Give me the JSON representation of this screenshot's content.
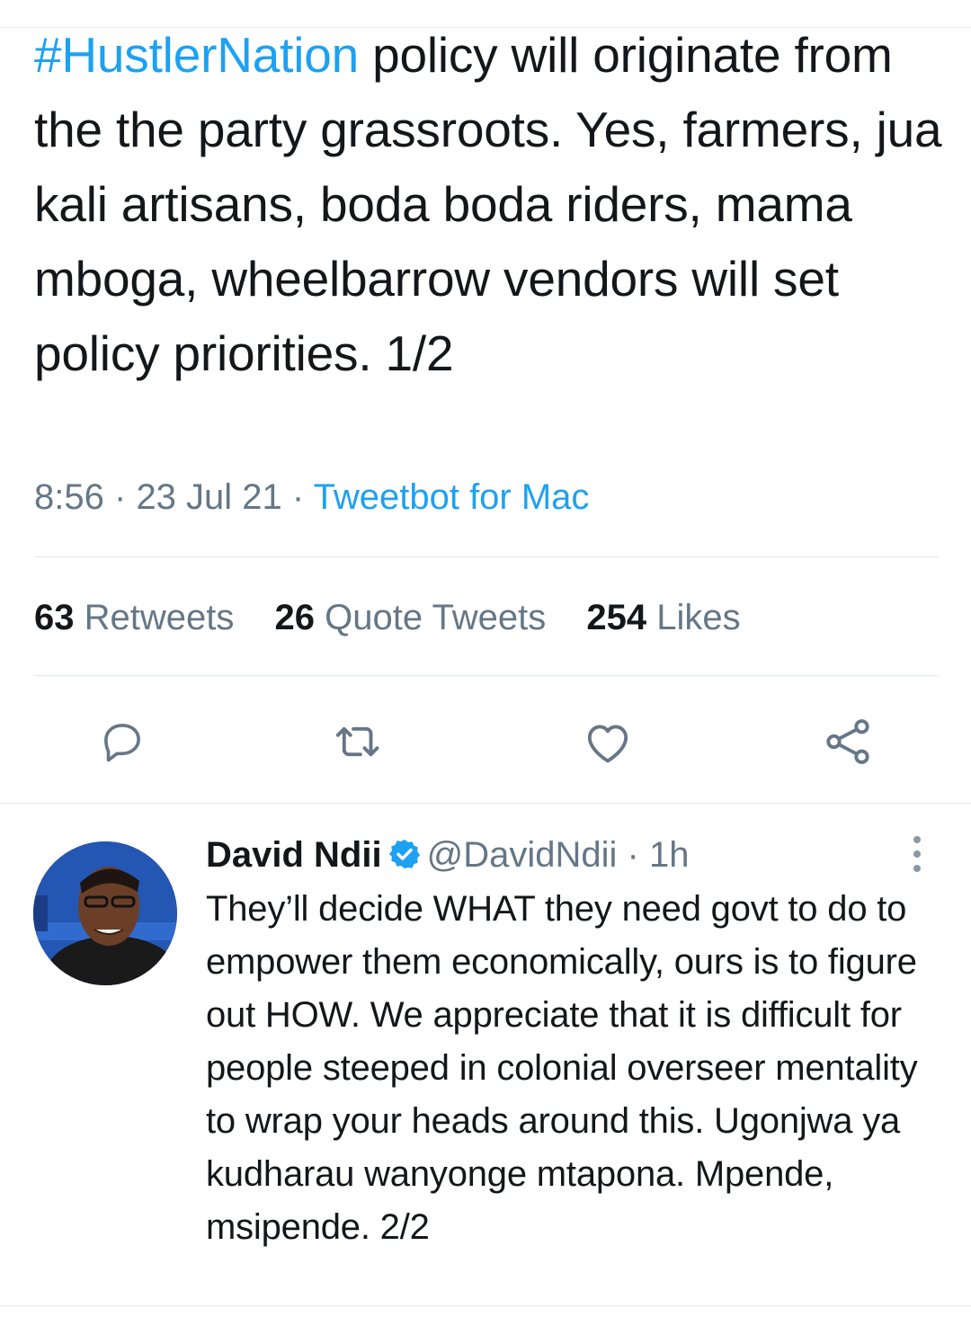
{
  "tweet": {
    "hashtag": "#HustlerNation",
    "text": " policy will originate from the the party grassroots. Yes, farmers, jua kali artisans, boda boda riders, mama mboga, wheelbarrow vendors will set policy priorities. 1/2",
    "time": "8:56",
    "date": "23 Jul 21",
    "source": "Tweetbot for Mac",
    "dot": "·"
  },
  "stats": {
    "retweets_count": "63",
    "retweets_label": "Retweets",
    "quotes_count": "26",
    "quotes_label": "Quote Tweets",
    "likes_count": "254",
    "likes_label": "Likes"
  },
  "actions": {
    "reply_icon": "comment-icon",
    "retweet_icon": "retweet-icon",
    "like_icon": "heart-icon",
    "share_icon": "share-icon"
  },
  "reply": {
    "name": "David Ndii",
    "handle": "@DavidNdii",
    "time": "1h",
    "dot": "·",
    "text": "They’ll decide WHAT they need govt to do to empower them economically, ours is to figure out HOW. We appreciate that it is difficult for people steeped in colonial overseer mentality to wrap your heads around this. Ugonjwa ya kudharau wanyonge mtapona. Mpende, msipende. 2/2"
  },
  "colors": {
    "accent": "#1da1f2",
    "text": "#14171a",
    "secondary": "#657786",
    "icon": "#657786",
    "divider": "#e1e8ed"
  }
}
